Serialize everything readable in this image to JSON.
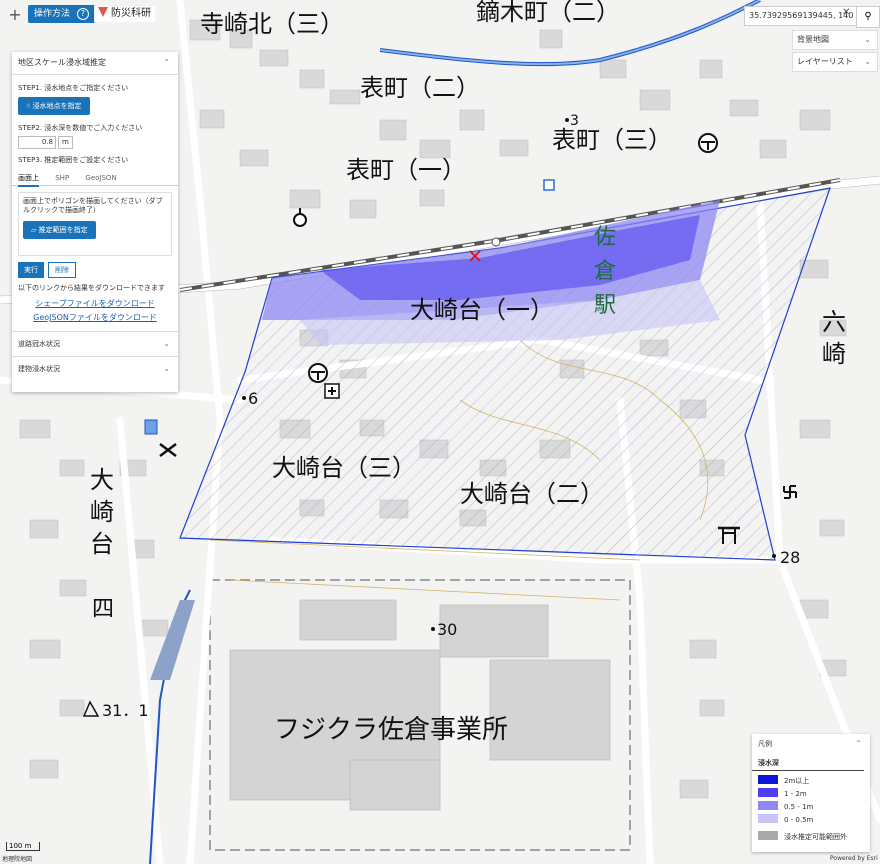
{
  "toolbar": {
    "zoom_in": "+",
    "howto_label": "操作方法",
    "help_glyph": "?",
    "brand": "防災科研"
  },
  "panel": {
    "title": "地区スケール浸水域推定",
    "step1": "STEP1. 浸水地点をご指定ください",
    "step1_button": "浸水地点を指定",
    "step2": "STEP2. 浸水深を数値でご入力ください",
    "depth_value": "0.8",
    "depth_unit": "m",
    "step3": "STEP3. 推定範囲をご設定ください",
    "tabs": [
      "画面上",
      "SHP",
      "GeoJSON"
    ],
    "draw_hint": "画面上でポリゴンを描画してください（ダブルクリックで描画終了）",
    "draw_button": "推定範囲を指定",
    "run_button": "実行",
    "clear_button": "削除",
    "download_note": "以下のリンクから結果をダウンロードできます",
    "shp_link": "シェープファイルをダウンロード",
    "geojson_link": "GeoJSONファイルをダウンロード",
    "road_status": "道路冠水状況",
    "building_status": "建物浸水状況"
  },
  "search": {
    "value": "35.73929569139445, 140",
    "clear_glyph": "✕",
    "search_glyph": "⚲"
  },
  "layers": {
    "basemap": "背景地図",
    "layer_list": "レイヤーリスト"
  },
  "legend": {
    "header": "凡例",
    "title": "浸水深",
    "items": [
      {
        "label": "2m以上",
        "color": "#0a16d8"
      },
      {
        "label": "1 - 2m",
        "color": "#4d3ff0"
      },
      {
        "label": "0.5 - 1m",
        "color": "#8f88f3"
      },
      {
        "label": "0 - 0.5m",
        "color": "#c7c4f7"
      },
      {
        "label": "浸水推定可能範囲外",
        "color": "#aaaaaa"
      }
    ]
  },
  "map": {
    "labels": {
      "terasaki_kita": "寺崎北（三）",
      "kabuki": "鏑木町（二）",
      "omote2": "表町（二）",
      "omote3": "表町（三）",
      "omote1": "表町（一）",
      "sakura_station_1": "佐",
      "sakura_station_2": "倉",
      "sakura_station_3": "駅",
      "osakidai1": "大崎台（一）",
      "osakidai3": "大崎台（三）",
      "osakidai2": "大崎台（二）",
      "osakidai4_a": "大",
      "osakidai4_b": "崎",
      "osakidai4_c": "台",
      "osakidai4_d": "四",
      "rokusaki_1": "六",
      "rokusaki_2": "崎",
      "fujikura": "フジクラ佐倉事業所",
      "elev_3": "3",
      "elev_6": "6",
      "elev_28": "28",
      "elev_30": "30",
      "elev_31": "31．1"
    }
  },
  "scale": "100 m",
  "credit_left": "地理院地図",
  "credit_right": "Powered by Esri"
}
